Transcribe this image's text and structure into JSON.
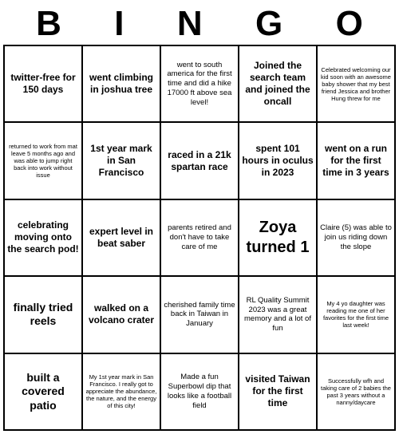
{
  "header": {
    "letters": [
      "B",
      "I",
      "N",
      "G",
      "O"
    ]
  },
  "cells": [
    {
      "text": "twitter-free for 150 days",
      "size": "medium-text"
    },
    {
      "text": "went climbing in joshua tree",
      "size": "medium-text"
    },
    {
      "text": "went to south america for the first time and did a hike 17000 ft above sea level!",
      "size": "small"
    },
    {
      "text": "Joined the search team and joined the oncall",
      "size": "medium-text"
    },
    {
      "text": "Celebrated welcoming our kid soon with an awesome baby shower that my best friend Jessica and brother Hung threw for me",
      "size": "tiny"
    },
    {
      "text": "returned to work from mat leave 5 months ago and was able to jump right back into work without issue",
      "size": "tiny"
    },
    {
      "text": "1st year mark in San Francisco",
      "size": "medium-text"
    },
    {
      "text": "raced in a 21k spartan race",
      "size": "medium-text"
    },
    {
      "text": "spent 101 hours in oculus in 2023",
      "size": "medium-text"
    },
    {
      "text": "went on a run for the first time in 3 years",
      "size": "medium-text"
    },
    {
      "text": "celebrating moving onto the search pod!",
      "size": "medium-text"
    },
    {
      "text": "expert level in beat saber",
      "size": "medium-text"
    },
    {
      "text": "parents retired and don't have to take care of me",
      "size": "small"
    },
    {
      "text": "Zoya turned 1",
      "size": "xl-text"
    },
    {
      "text": "Claire (5) was able to join us riding down the slope",
      "size": "small"
    },
    {
      "text": "finally tried reels",
      "size": "large-text"
    },
    {
      "text": "walked on a volcano crater",
      "size": "medium-text"
    },
    {
      "text": "cherished family time back in Taiwan in January",
      "size": "small"
    },
    {
      "text": "RL Quality Summit 2023 was a great memory and a lot of fun",
      "size": "small"
    },
    {
      "text": "My 4 yo daughter was reading me one of her favorites for the first time last week!",
      "size": "tiny"
    },
    {
      "text": "built a covered patio",
      "size": "large-text"
    },
    {
      "text": "My 1st year mark in San Francisco. I really got to appreciate the abundance, the nature, and the energy of this city!",
      "size": "tiny"
    },
    {
      "text": "Made a fun Superbowl dip that looks like a football field",
      "size": "small"
    },
    {
      "text": "visited Taiwan for the first time",
      "size": "medium-text"
    },
    {
      "text": "Successfully wfh and taking care of 2 babies the past 3 years without a nanny/daycare",
      "size": "tiny"
    }
  ]
}
